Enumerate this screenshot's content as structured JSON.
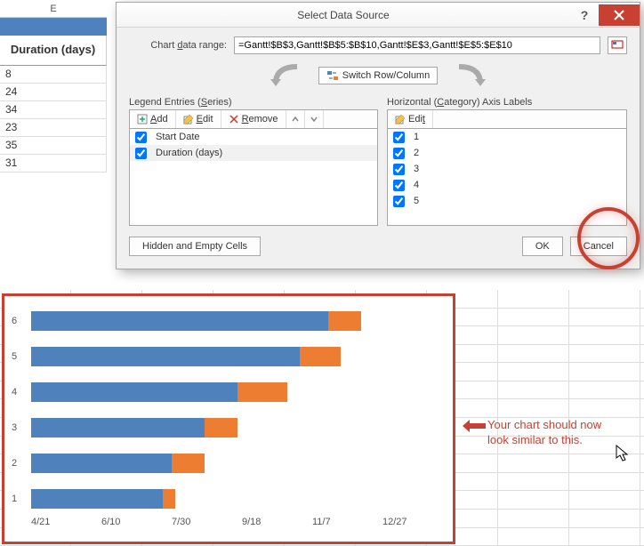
{
  "sheet": {
    "column_letter": "E",
    "header": "Duration (days)",
    "values": [
      "8",
      "24",
      "34",
      "23",
      "35",
      "31"
    ]
  },
  "dialog": {
    "title": "Select Data Source",
    "range_label_html": "Chart data range:",
    "range_value": "=Gantt!$B$3,Gantt!$B$5:$B$10,Gantt!$E$3,Gantt!$E$5:$E$10",
    "switch_label": "Switch Row/Column",
    "legend_title": "Legend Entries (Series)",
    "horiz_title": "Horizontal (Category) Axis Labels",
    "buttons": {
      "add": "Add",
      "edit": "Edit",
      "remove": "Remove",
      "edit2": "Edit",
      "hidden": "Hidden and Empty Cells",
      "ok": "OK",
      "cancel": "Cancel"
    },
    "series": [
      {
        "label": "Start Date",
        "checked": true,
        "selected": false
      },
      {
        "label": "Duration (days)",
        "checked": true,
        "selected": true
      }
    ],
    "categories": [
      {
        "label": "1",
        "checked": true
      },
      {
        "label": "2",
        "checked": true
      },
      {
        "label": "3",
        "checked": true
      },
      {
        "label": "4",
        "checked": true
      },
      {
        "label": "5",
        "checked": true
      }
    ]
  },
  "annotation": {
    "line1": "Your chart should now",
    "line2": "look similar to this."
  },
  "chart_data": {
    "type": "bar",
    "orientation": "horizontal",
    "categories": [
      "6",
      "5",
      "4",
      "3",
      "2",
      "1"
    ],
    "x_ticks": [
      "4/21",
      "6/10",
      "7/30",
      "9/18",
      "11/7",
      "12/27"
    ],
    "series": [
      {
        "name": "Start Date",
        "color": "#4f81bd",
        "offsets_pct": [
          0,
          0,
          0,
          0,
          0,
          0
        ],
        "widths_pct": [
          72,
          65,
          50,
          42,
          34,
          32
        ]
      },
      {
        "name": "Duration (days)",
        "color": "#ed7d31",
        "offsets_pct": [
          72,
          65,
          50,
          42,
          34,
          32
        ],
        "widths_pct": [
          8,
          10,
          12,
          8,
          8,
          3
        ]
      }
    ],
    "xlabel": "",
    "ylabel": "",
    "legend": "none"
  }
}
